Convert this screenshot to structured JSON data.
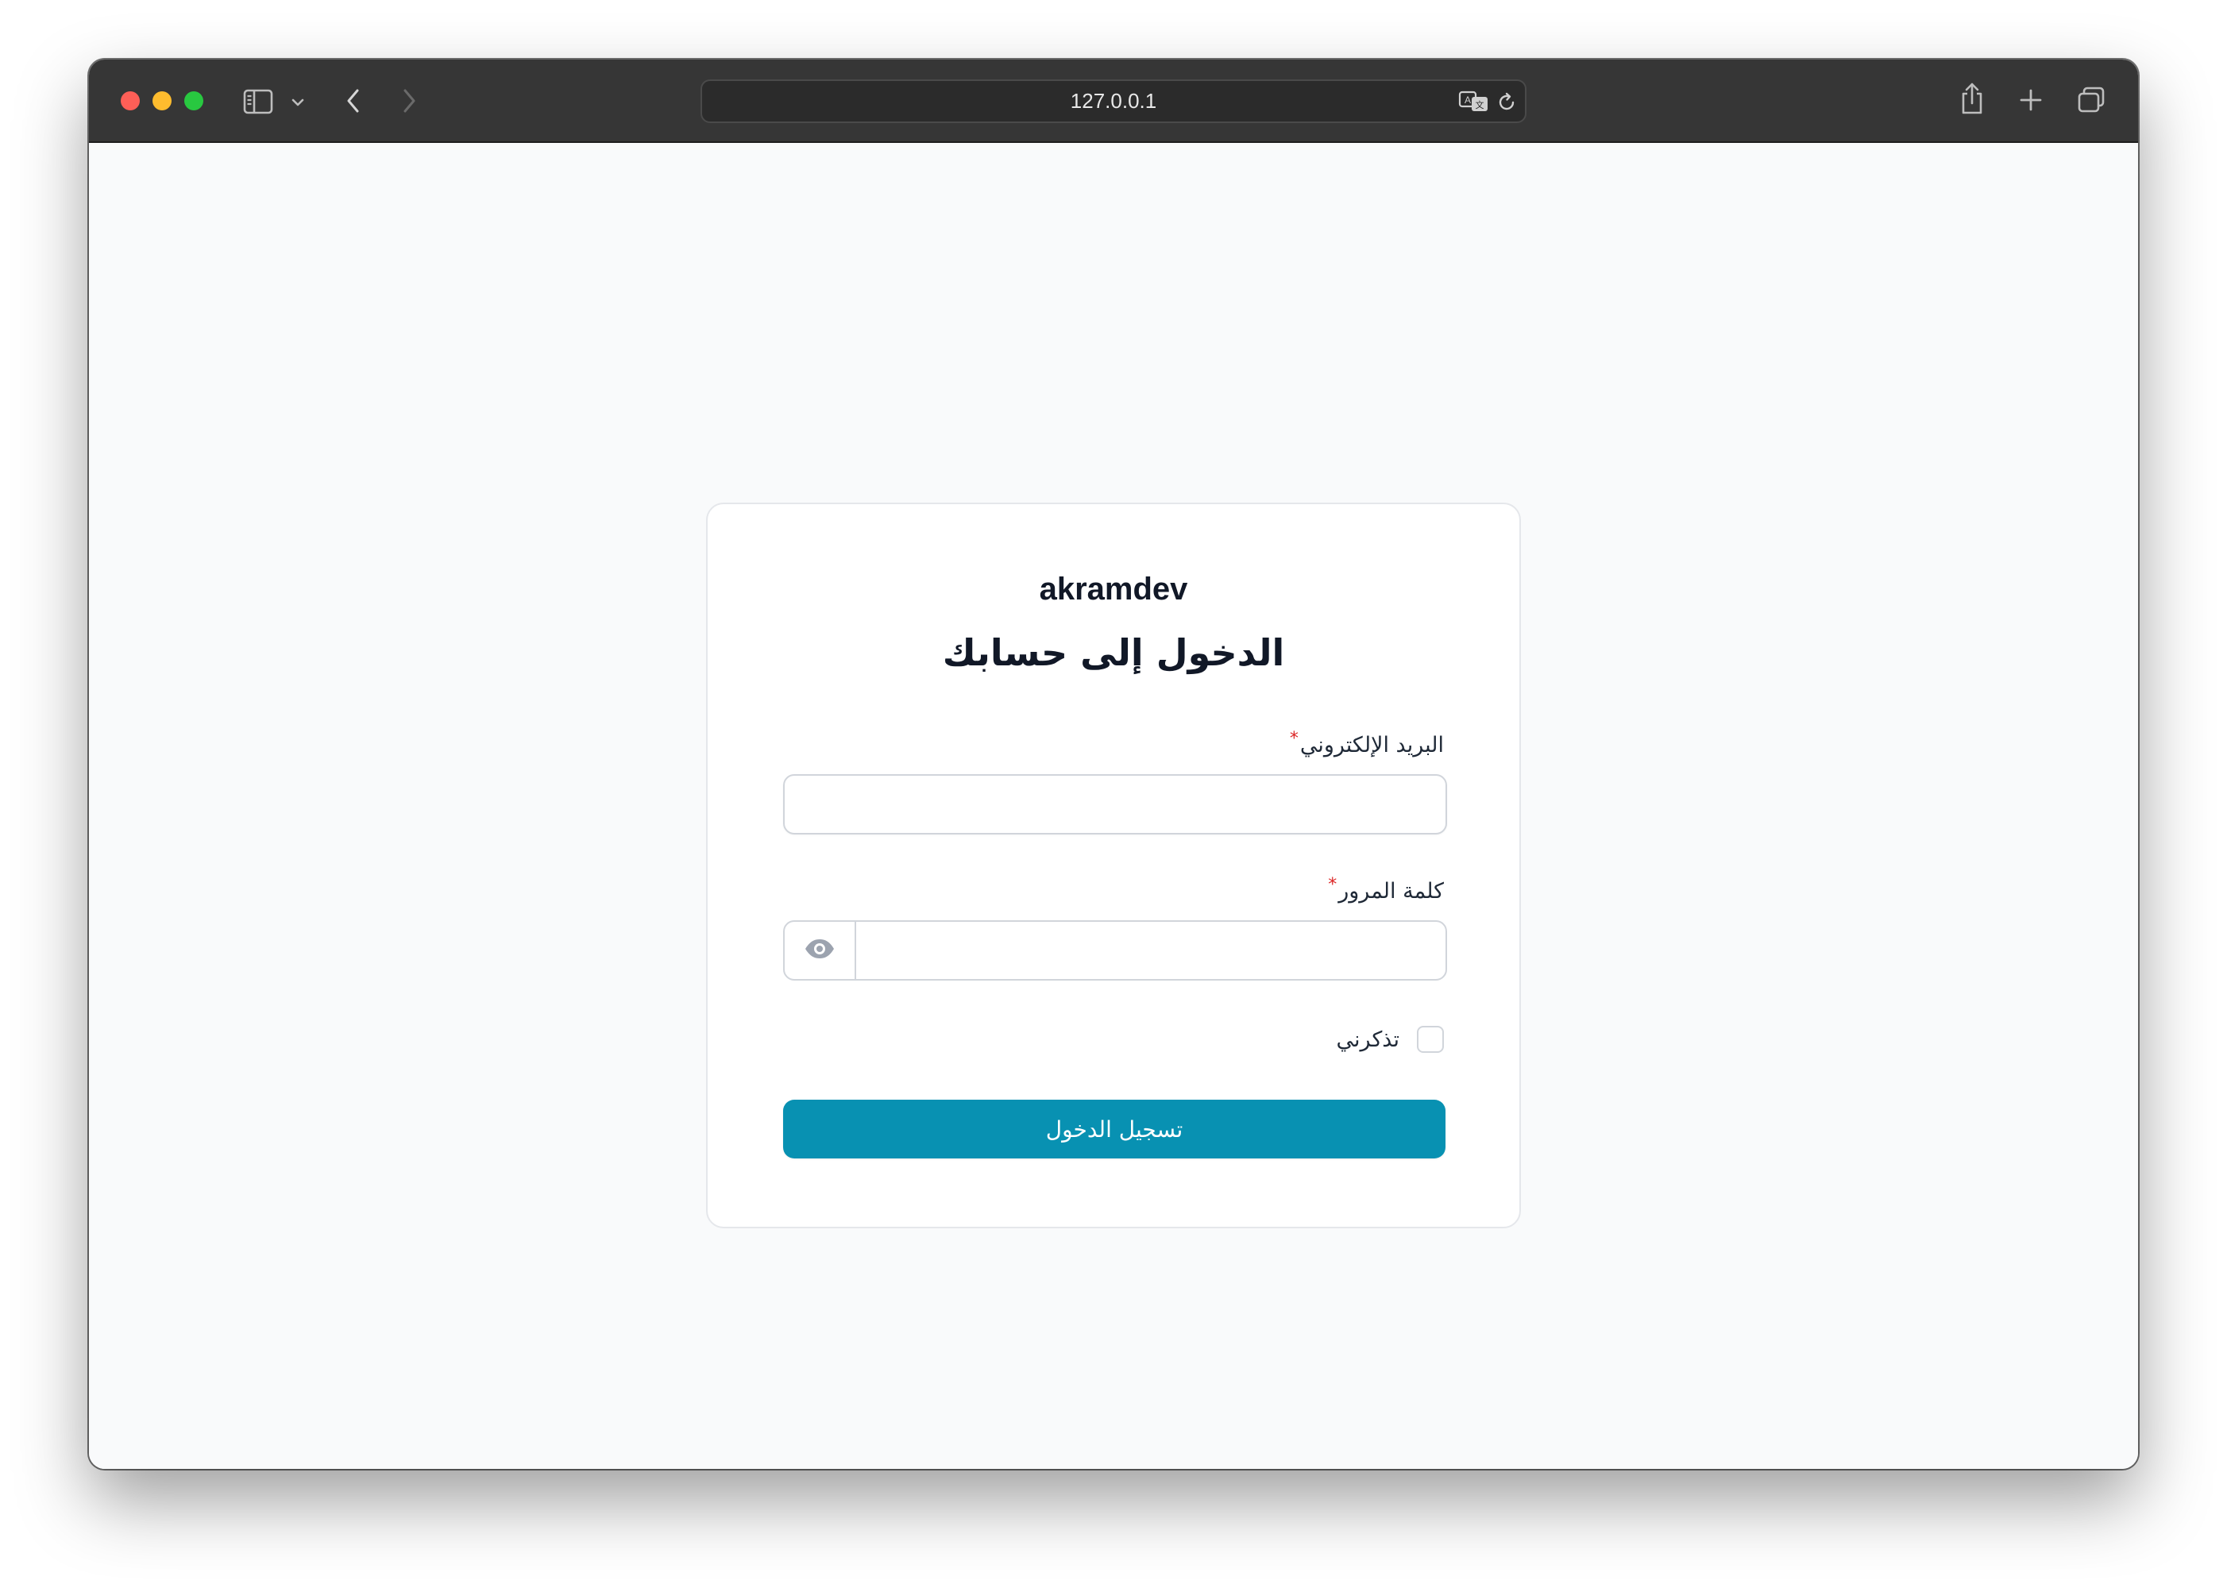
{
  "browser": {
    "url": "127.0.0.1",
    "icons": {
      "sidebar": "sidebar-icon",
      "sidebar_menu": "chevron-down-icon",
      "back": "chevron-left-icon",
      "forward": "chevron-right-icon",
      "translate": "translate-icon",
      "reload": "reload-icon",
      "share": "share-icon",
      "new_tab": "plus-icon",
      "tabs_overview": "tabs-icon"
    }
  },
  "login": {
    "brand": "akramdev",
    "heading": "الدخول إلى حسابك",
    "email_label": "البريد الإلكتروني",
    "email_value": "",
    "password_label": "كلمة المرور",
    "password_value": "",
    "required_mark": "*",
    "remember_label": "تذكرني",
    "remember_checked": false,
    "submit_label": "تسجيل الدخول",
    "colors": {
      "primary": "#0891b2",
      "required": "#dc2626",
      "background": "#f9fafb"
    }
  }
}
